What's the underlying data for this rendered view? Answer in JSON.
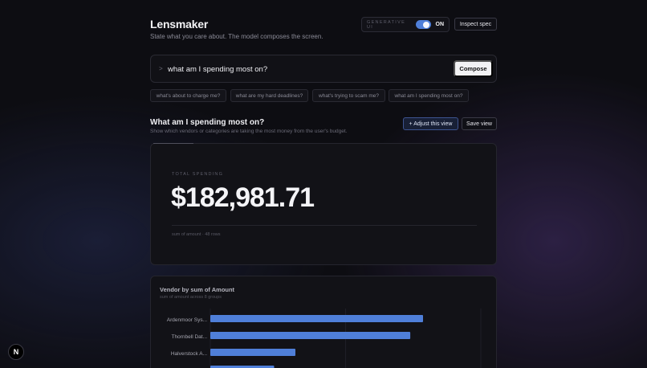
{
  "app": {
    "title": "Lensmaker",
    "subtitle": "State what you care about. The model composes the screen."
  },
  "header": {
    "generative_label": "GENERATIVE UI",
    "generative_state": "ON",
    "generative_enabled": true,
    "inspect_label": "Inspect spec"
  },
  "prompt": {
    "caret": ">",
    "value": "what am I spending most on?",
    "compose_label": "Compose"
  },
  "suggestions": [
    "what's about to charge me?",
    "what are my hard deadlines?",
    "what's trying to scam me?",
    "what am I spending most on?"
  ],
  "view": {
    "title": "What am I spending most on?",
    "description": "Show which vendors or categories are taking the most money from the user's budget.",
    "adjust_label": "+ Adjust this view",
    "save_label": "Save view"
  },
  "kpi": {
    "label": "TOTAL SPENDING",
    "value": "$182,981.71",
    "footnote": "sum of amount · 48 rows"
  },
  "chart_data": {
    "type": "bar",
    "orientation": "horizontal",
    "title": "Vendor by sum of Amount",
    "subtitle": "sum of amount across 8 groups",
    "categories": [
      "Ardenmoor Sys...",
      "Thornbell Dat...",
      "Halverstock A...",
      ""
    ],
    "values": [
      100,
      94,
      40,
      30
    ],
    "bar_color": "#4f7fd9",
    "grid": true
  },
  "badge": {
    "letter": "N"
  },
  "colors": {
    "accent": "#4f7fd9",
    "background": "#0d0d12",
    "card": "#121217"
  }
}
